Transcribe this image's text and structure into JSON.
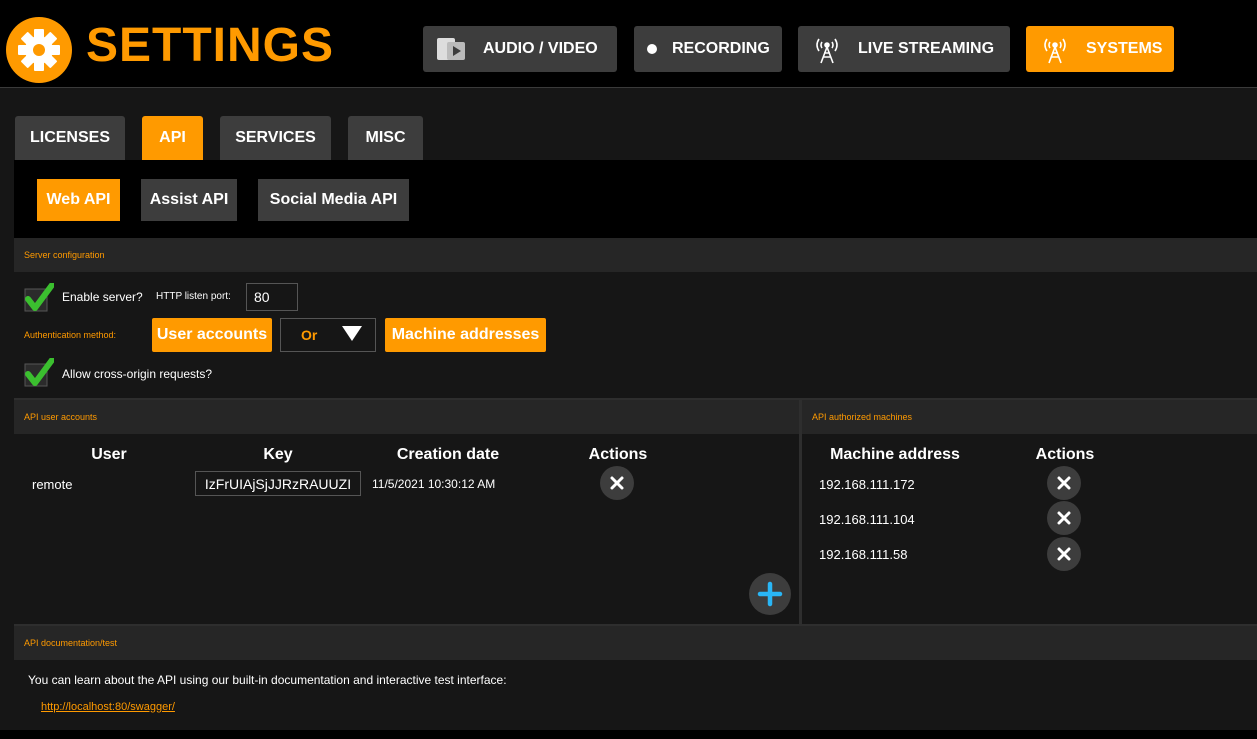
{
  "header": {
    "title": "SETTINGS",
    "nav": [
      {
        "label": "AUDIO / VIDEO",
        "icon": "media-icon"
      },
      {
        "label": "RECORDING",
        "icon": "record-dot-icon"
      },
      {
        "label": "LIVE STREAMING",
        "icon": "antenna-icon"
      },
      {
        "label": "SYSTEMS",
        "icon": "antenna-icon",
        "active": true
      }
    ]
  },
  "tabs": [
    {
      "label": "LICENSES"
    },
    {
      "label": "API",
      "active": true
    },
    {
      "label": "SERVICES"
    },
    {
      "label": "MISC"
    }
  ],
  "subtabs": [
    {
      "label": "Web API",
      "active": true
    },
    {
      "label": "Assist API"
    },
    {
      "label": "Social Media API"
    }
  ],
  "server_config": {
    "heading": "Server configuration",
    "enable_label": "Enable server?",
    "enable_checked": true,
    "port_label": "HTTP listen port:",
    "port_value": "80",
    "auth_label": "Authentication method:",
    "auth_user_btn": "User accounts",
    "auth_combinator": "Or",
    "auth_machine_btn": "Machine addresses",
    "cors_label": "Allow cross-origin requests?",
    "cors_checked": true
  },
  "user_accounts": {
    "heading": "API user accounts",
    "columns": [
      "User",
      "Key",
      "Creation date",
      "Actions"
    ],
    "rows": [
      {
        "user": "remote",
        "key": "IzFrUIAjSjJJRzRAUUZI",
        "created": "11/5/2021 10:30:12 AM"
      }
    ]
  },
  "machines": {
    "heading": "API authorized machines",
    "columns": [
      "Machine address",
      "Actions"
    ],
    "rows": [
      {
        "address": "192.168.111.172"
      },
      {
        "address": "192.168.111.104"
      },
      {
        "address": "192.168.111.58"
      }
    ]
  },
  "docs": {
    "heading": "API documentation/test",
    "text": "You can learn about the API using our built-in documentation and interactive test interface:",
    "link": "http://localhost:80/swagger/"
  },
  "colors": {
    "accent": "#ff9a00",
    "panel": "#161616",
    "button": "#3d3d3d",
    "add": "#29b6f6"
  }
}
